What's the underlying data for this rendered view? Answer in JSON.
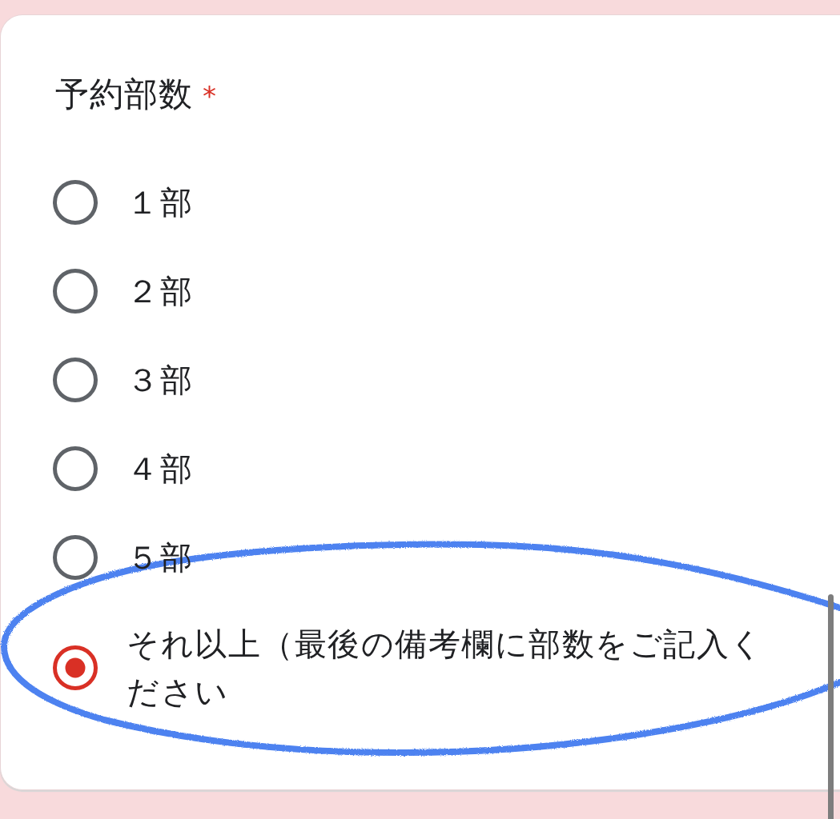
{
  "question": {
    "title": "予約部数",
    "required_mark": "*"
  },
  "options": [
    {
      "label": "１部",
      "selected": false
    },
    {
      "label": "２部",
      "selected": false
    },
    {
      "label": "３部",
      "selected": false
    },
    {
      "label": "４部",
      "selected": false
    },
    {
      "label": "５部",
      "selected": false
    },
    {
      "label": "それ以上（最後の備考欄に部数をご記入ください",
      "selected": true
    }
  ]
}
